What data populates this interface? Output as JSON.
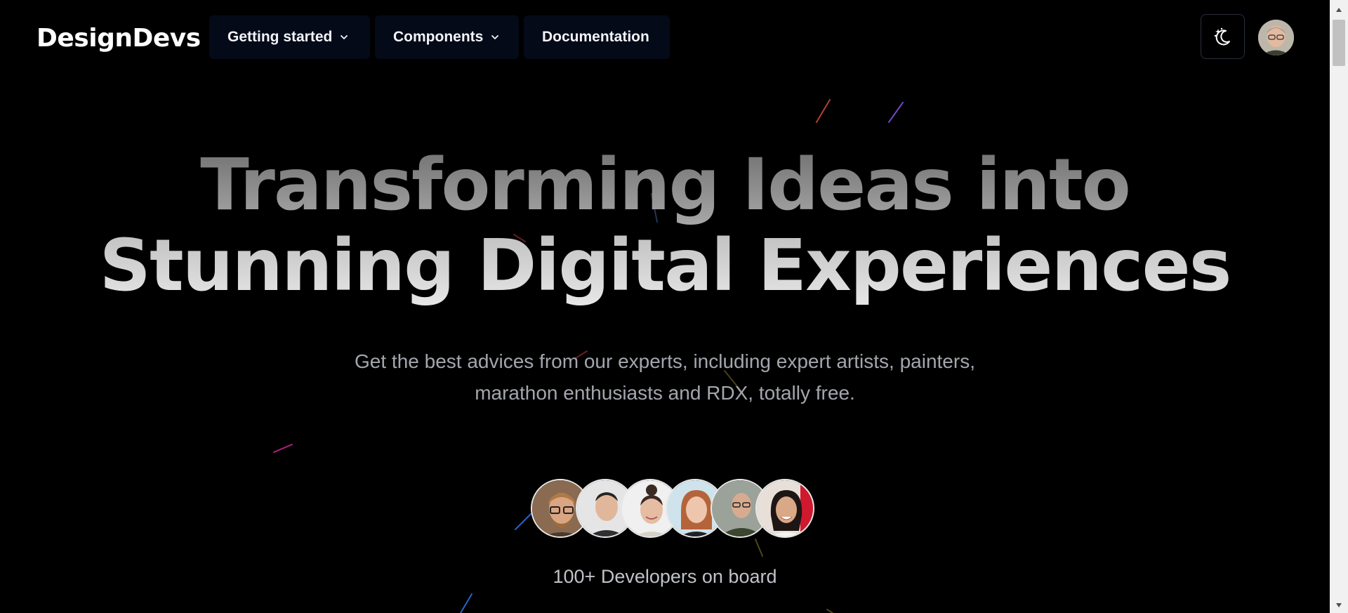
{
  "brand": {
    "name": "DesignDevs"
  },
  "nav": {
    "items": [
      {
        "label": "Getting started",
        "has_dropdown": true
      },
      {
        "label": "Components",
        "has_dropdown": true
      },
      {
        "label": "Documentation",
        "has_dropdown": false
      }
    ],
    "theme_toggle_icon": "moon-stars-icon",
    "profile_avatar_icon": "user-avatar"
  },
  "hero": {
    "title_line1": "Transforming Ideas into",
    "title_line2": "Stunning Digital Experiences",
    "subtitle_line1": "Get the best advices from our experts, including expert artists, painters,",
    "subtitle_line2": "marathon enthusiasts and RDX, totally free.",
    "developer_avatars": [
      "developer-1",
      "developer-2",
      "developer-3",
      "developer-4",
      "developer-5",
      "developer-6"
    ],
    "developers_label": "100+ Developers on board"
  },
  "colors": {
    "background": "#000000",
    "nav_button_bg": "#040a18",
    "text_primary": "#ffffff",
    "text_muted": "#a3a6ad"
  }
}
